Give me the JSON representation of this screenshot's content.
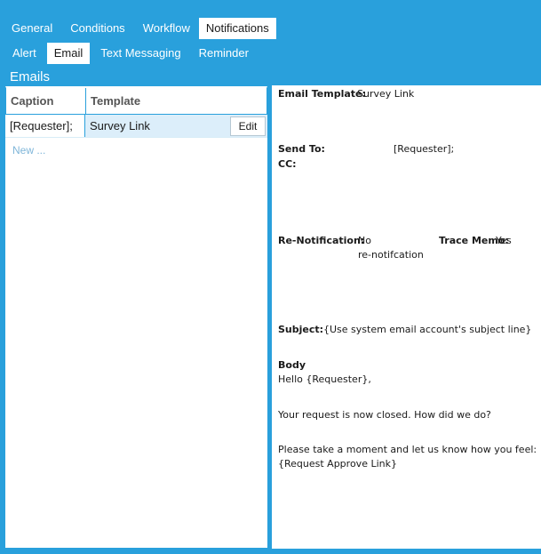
{
  "tabs_primary": [
    "General",
    "Conditions",
    "Workflow",
    "Notifications"
  ],
  "tabs_secondary": [
    "Alert",
    "Email",
    "Text Messaging",
    "Reminder"
  ],
  "emails_panel": {
    "title": "Emails",
    "columns": [
      "Caption",
      "Template"
    ],
    "rows": [
      {
        "caption": "[Requester];",
        "template": "Survey Link",
        "action": "Edit"
      }
    ],
    "new_label": "New ..."
  },
  "details": {
    "template_label": "Email Template:",
    "template_value": "Survey Link",
    "send_to_label": "Send To:",
    "send_to_value": "[Requester];",
    "cc_label": "CC:",
    "renotification_label": "Re-Notification:",
    "renotification_value_line1": "No",
    "renotification_value_line2": "re-notifcation",
    "trace_memo_label": "Trace Memo:",
    "trace_memo_value": "Yes",
    "subject_label": "Subject:",
    "subject_value": "{Use system email account's subject line}",
    "body_label": "Body",
    "body_lines": [
      "Hello {Requester},",
      "Your request is now closed. How did we do?",
      "Please take a moment and let us know how you feel:",
      "{Request Approve Link}"
    ]
  }
}
